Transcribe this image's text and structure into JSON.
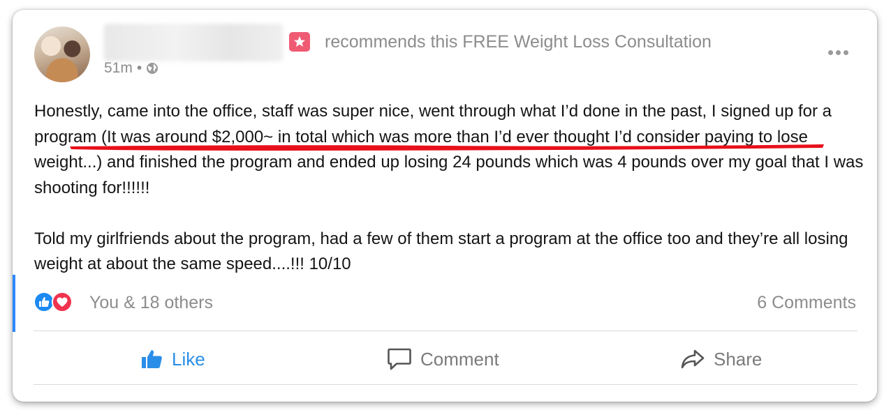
{
  "post": {
    "recommends_text": "recommends this FREE Weight Loss Consultation",
    "time": "51m",
    "separator": "•",
    "paragraphs": [
      "Honestly, came into the office, staff was super nice, went through what I’d done in the past, I signed up for a program (It was around $2,000~ in total which was more than I’d ever thought I’d consider paying to lose weight...) and finished the program and ended up losing 24 pounds which was 4 pounds over my goal that I was shooting for!!!!!!",
      "Told my girlfriends about the program, had a few of them start a program at the office too and they’re all losing weight at about the same speed....!!!  10/10"
    ]
  },
  "reactions": {
    "summary": "You & 18 others",
    "comments": "6 Comments",
    "types": [
      "like-icon",
      "heart-icon"
    ]
  },
  "actions": {
    "like": "Like",
    "comment": "Comment",
    "share": "Share"
  },
  "colors": {
    "accent": "#2a8ee8",
    "underline": "#e8101a",
    "badge": "#f05b74",
    "love": "#f0334f"
  }
}
